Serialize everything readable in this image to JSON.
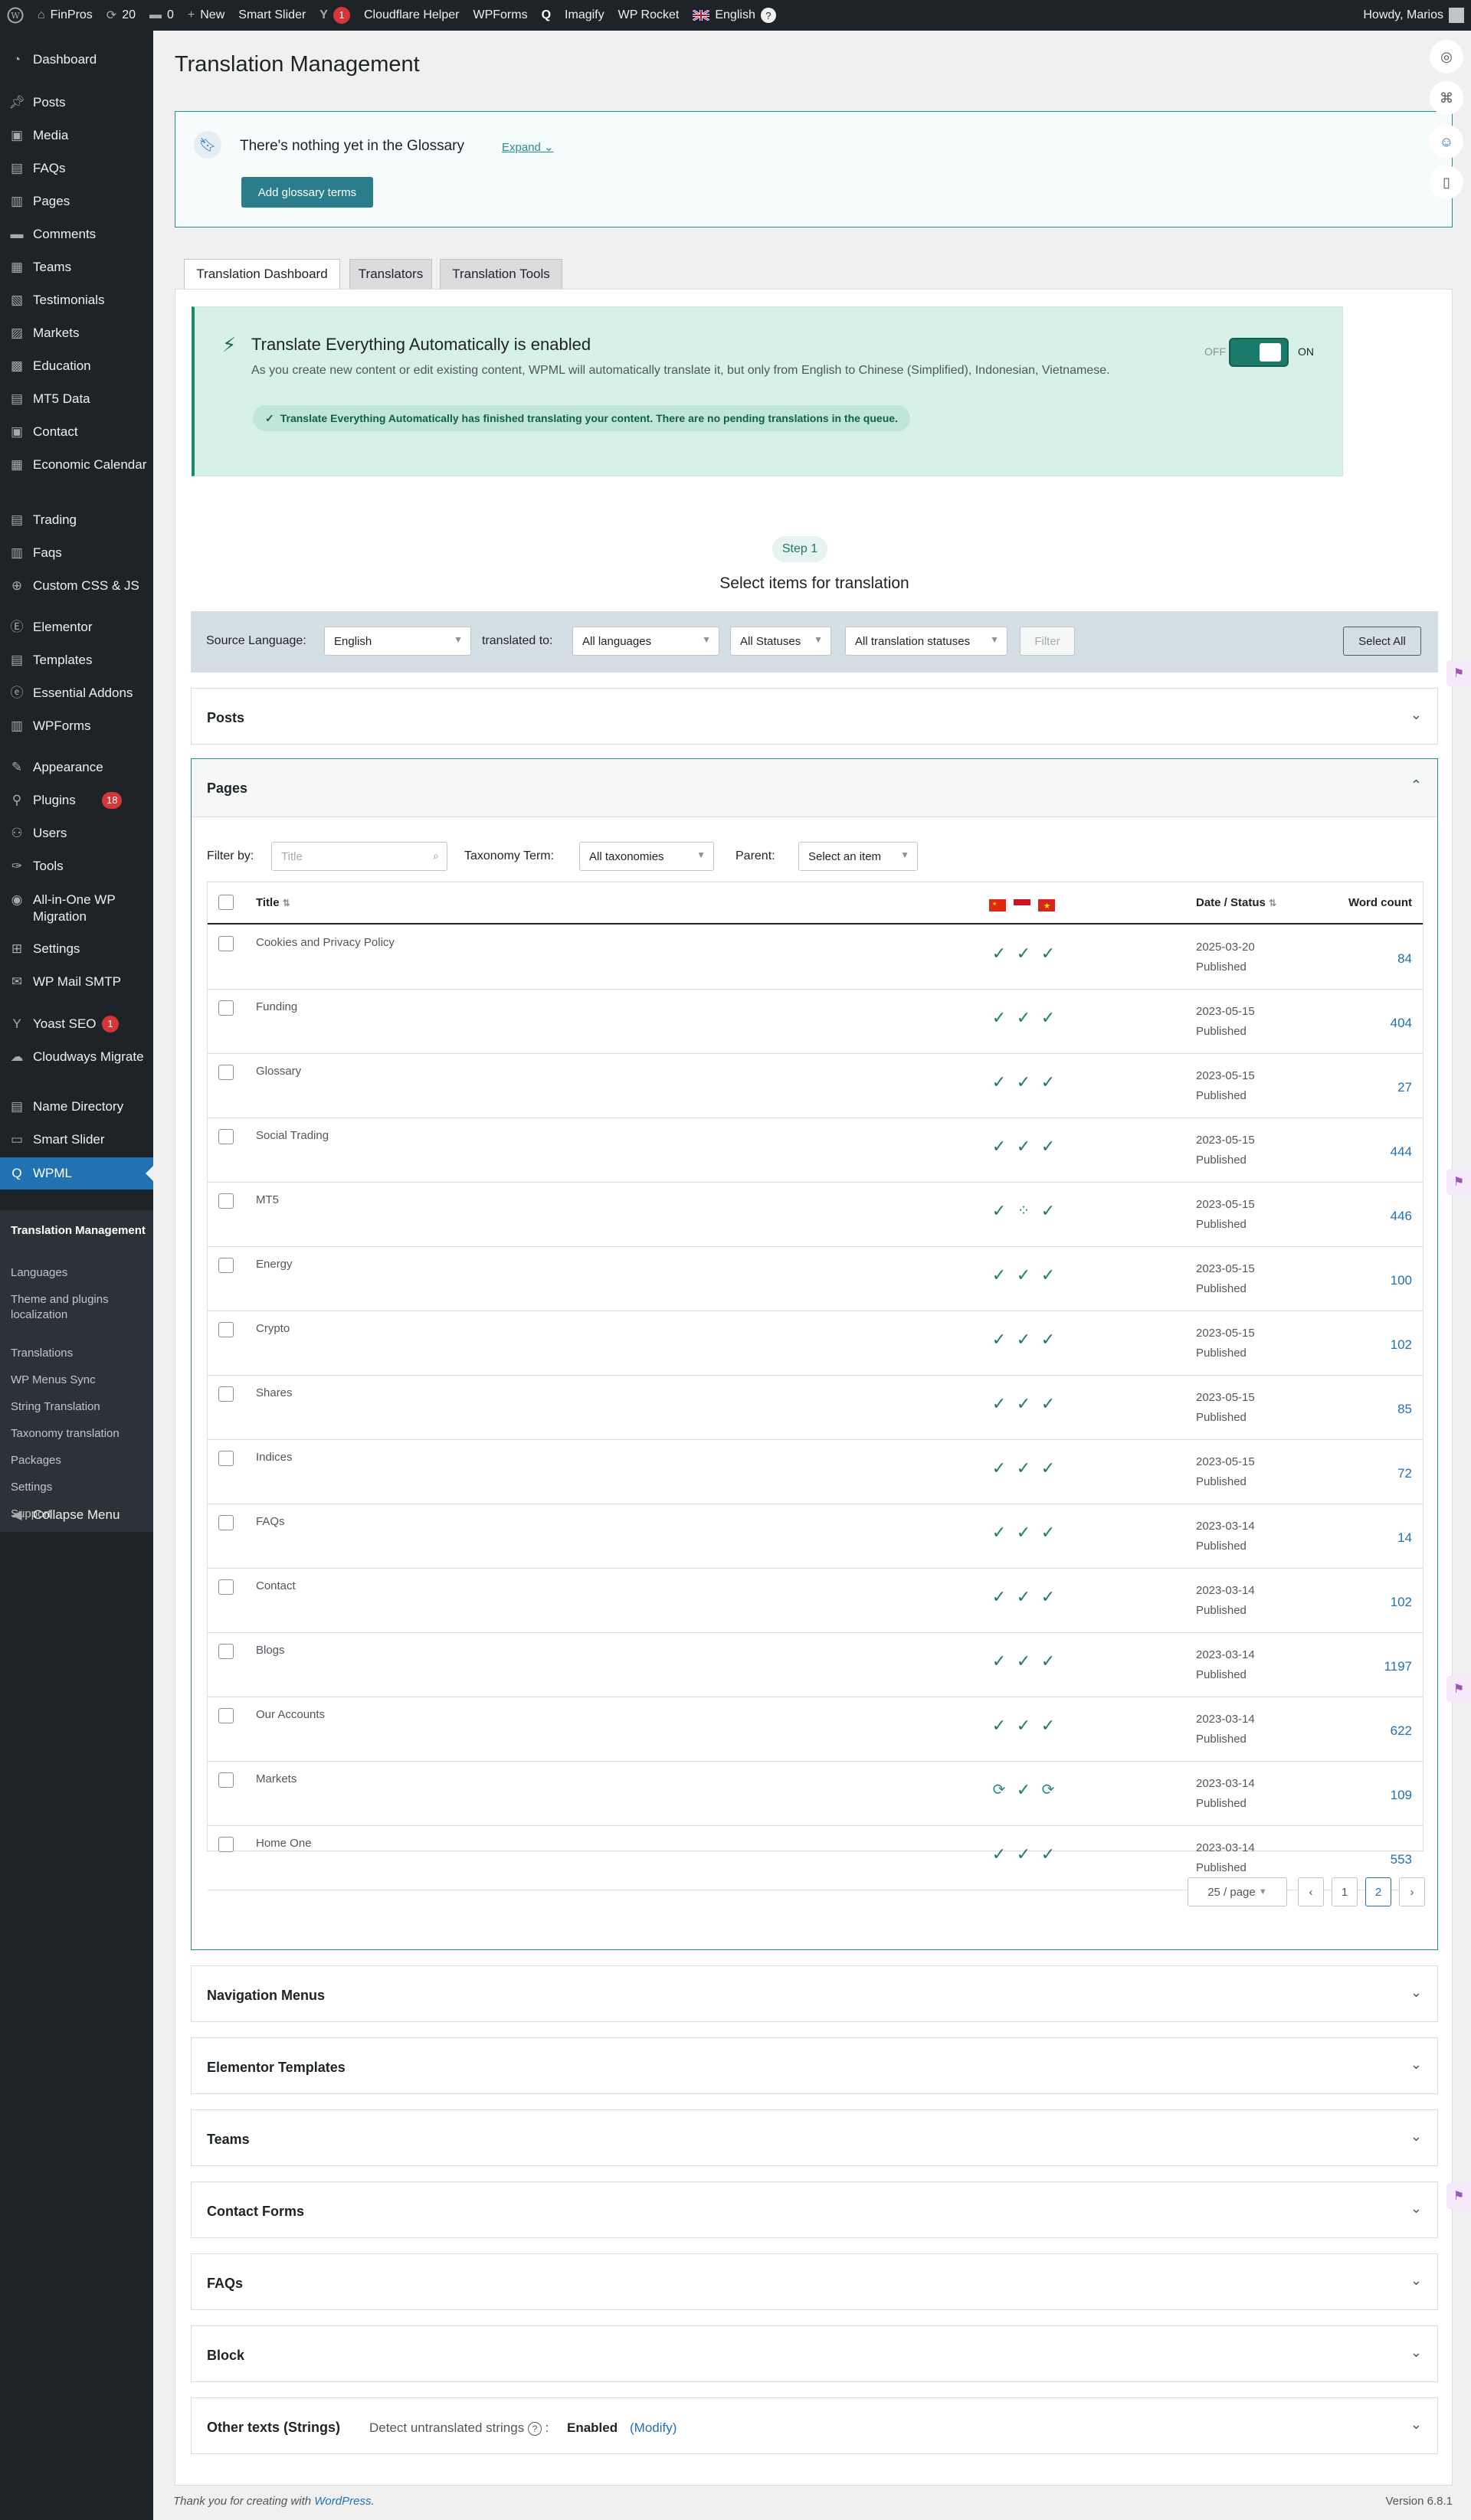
{
  "admin_bar": {
    "site_name": "FinPros",
    "updates_count": "20",
    "comments_count": "0",
    "new_label": "New",
    "smart_slider": "Smart Slider",
    "yoast_badge": "1",
    "cloudflare": "Cloudflare Helper",
    "wpforms": "WPForms",
    "imagify": "Imagify",
    "wp_rocket": "WP Rocket",
    "language": "English",
    "howdy": "Howdy, Marios"
  },
  "sidebar": {
    "items": [
      {
        "label": "Dashboard",
        "icon": "dashboard-icon"
      },
      {
        "label": "Posts",
        "icon": "pin-icon"
      },
      {
        "label": "Media",
        "icon": "media-icon"
      },
      {
        "label": "FAQs",
        "icon": "faq-icon"
      },
      {
        "label": "Pages",
        "icon": "pages-icon"
      },
      {
        "label": "Comments",
        "icon": "comments-icon"
      },
      {
        "label": "Teams",
        "icon": "teams-icon"
      },
      {
        "label": "Testimonials",
        "icon": "testimonials-icon"
      },
      {
        "label": "Markets",
        "icon": "markets-icon"
      },
      {
        "label": "Education",
        "icon": "education-icon"
      },
      {
        "label": "MT5 Data",
        "icon": "data-icon"
      },
      {
        "label": "Contact",
        "icon": "contact-icon"
      },
      {
        "label": "Economic Calendar",
        "icon": "calendar-icon"
      },
      {
        "label": "Trading",
        "icon": "trading-icon"
      },
      {
        "label": "Faqs",
        "icon": "faqs-icon"
      },
      {
        "label": "Custom CSS & JS",
        "icon": "plus-icon"
      },
      {
        "label": "Elementor",
        "icon": "elementor-icon"
      },
      {
        "label": "Templates",
        "icon": "templates-icon"
      },
      {
        "label": "Essential Addons",
        "icon": "addons-icon"
      },
      {
        "label": "WPForms",
        "icon": "wpforms-icon"
      },
      {
        "label": "Appearance",
        "icon": "appearance-icon"
      },
      {
        "label": "Plugins",
        "icon": "plugins-icon",
        "badge": "18"
      },
      {
        "label": "Users",
        "icon": "users-icon"
      },
      {
        "label": "Tools",
        "icon": "tools-icon"
      },
      {
        "label": "All-in-One WP Migration",
        "icon": "migration-icon"
      },
      {
        "label": "Settings",
        "icon": "settings-icon"
      },
      {
        "label": "WP Mail SMTP",
        "icon": "mail-icon"
      },
      {
        "label": "Yoast SEO",
        "icon": "yoast-icon",
        "badge": "1"
      },
      {
        "label": "Cloudways Migrate",
        "icon": "cloud-icon"
      },
      {
        "label": "Name Directory",
        "icon": "directory-icon"
      },
      {
        "label": "Smart Slider",
        "icon": "slider-icon"
      },
      {
        "label": "WPML",
        "icon": "wpml-icon"
      }
    ],
    "submenu": [
      "Translation Management",
      "Languages",
      "Theme and plugins localization",
      "Translations",
      "WP Menus Sync",
      "String Translation",
      "Taxonomy translation",
      "Packages",
      "Settings",
      "Support"
    ],
    "collapse": "Collapse Menu"
  },
  "page": {
    "title": "Translation Management",
    "glossary": {
      "title": "There's nothing yet in the Glossary",
      "expand": "Expand",
      "button": "Add glossary terms"
    },
    "tabs": [
      "Translation Dashboard",
      "Translators",
      "Translation Tools"
    ],
    "notice": {
      "title": "Translate Everything Automatically is enabled",
      "description": "As you create new content or edit existing content, WPML will automatically translate it, but only from English to Chinese (Simplified), Indonesian, Vietnamese.",
      "status": "Translate Everything Automatically has finished translating your content. There are no pending translations in the queue.",
      "off": "OFF",
      "on": "ON"
    },
    "step": "Step 1",
    "select_title": "Select items for translation",
    "filters": {
      "source_label": "Source Language:",
      "source_value": "English",
      "translated_label": "translated to:",
      "languages": "All languages",
      "statuses": "All Statuses",
      "translation_statuses": "All translation statuses",
      "filter_button": "Filter",
      "select_all": "Select All"
    },
    "sections": [
      "Posts",
      "Navigation Menus",
      "Elementor Templates",
      "Teams",
      "Contact Forms",
      "FAQs",
      "Block"
    ],
    "pages_section": {
      "title": "Pages",
      "filter_by": "Filter by:",
      "title_placeholder": "Title",
      "taxonomy_label": "Taxonomy Term:",
      "taxonomy_value": "All taxonomies",
      "parent_label": "Parent:",
      "parent_value": "Select an item",
      "columns": {
        "title": "Title",
        "date": "Date / Status",
        "wordcount": "Word count"
      },
      "flag_colors": [
        "#de2910",
        "#ce1126",
        "#da251d"
      ],
      "rows": [
        {
          "title": "Cookies and Privacy Policy",
          "date": "2025-03-20",
          "status": "Published",
          "words": "84",
          "s": [
            "✓",
            "✓",
            "✓"
          ]
        },
        {
          "title": "Funding",
          "date": "2023-05-15",
          "status": "Published",
          "words": "404",
          "s": [
            "✓",
            "✓",
            "✓"
          ]
        },
        {
          "title": "Glossary",
          "date": "2023-05-15",
          "status": "Published",
          "words": "27",
          "s": [
            "✓",
            "✓",
            "✓"
          ]
        },
        {
          "title": "Social Trading",
          "date": "2023-05-15",
          "status": "Published",
          "words": "444",
          "s": [
            "✓",
            "✓",
            "✓"
          ]
        },
        {
          "title": "MT5",
          "date": "2023-05-15",
          "status": "Published",
          "words": "446",
          "s": [
            "✓",
            "⁘",
            "✓"
          ]
        },
        {
          "title": "Energy",
          "date": "2023-05-15",
          "status": "Published",
          "words": "100",
          "s": [
            "✓",
            "✓",
            "✓"
          ]
        },
        {
          "title": "Crypto",
          "date": "2023-05-15",
          "status": "Published",
          "words": "102",
          "s": [
            "✓",
            "✓",
            "✓"
          ]
        },
        {
          "title": "Shares",
          "date": "2023-05-15",
          "status": "Published",
          "words": "85",
          "s": [
            "✓",
            "✓",
            "✓"
          ]
        },
        {
          "title": "Indices",
          "date": "2023-05-15",
          "status": "Published",
          "words": "72",
          "s": [
            "✓",
            "✓",
            "✓"
          ]
        },
        {
          "title": "FAQs",
          "date": "2023-03-14",
          "status": "Published",
          "words": "14",
          "s": [
            "✓",
            "✓",
            "✓"
          ]
        },
        {
          "title": "Contact",
          "date": "2023-03-14",
          "status": "Published",
          "words": "102",
          "s": [
            "✓",
            "✓",
            "✓"
          ]
        },
        {
          "title": "Blogs",
          "date": "2023-03-14",
          "status": "Published",
          "words": "1197",
          "s": [
            "✓",
            "✓",
            "✓"
          ]
        },
        {
          "title": "Our Accounts",
          "date": "2023-03-14",
          "status": "Published",
          "words": "622",
          "s": [
            "✓",
            "✓",
            "✓"
          ]
        },
        {
          "title": "Markets",
          "date": "2023-03-14",
          "status": "Published",
          "words": "109",
          "s": [
            "⟳",
            "✓",
            "⟳"
          ]
        },
        {
          "title": "Home One",
          "date": "2023-03-14",
          "status": "Published",
          "words": "553",
          "s": [
            "✓",
            "✓",
            "✓"
          ]
        }
      ],
      "pagination": {
        "per_page": "25 / page",
        "pages": [
          "1",
          "2"
        ],
        "current": "2"
      }
    },
    "strings_section": {
      "title": "Other texts (Strings)",
      "detect_label": "Detect untranslated strings",
      "value": "Enabled",
      "modify": "(Modify)"
    },
    "footer": {
      "text": "Thank you for creating with",
      "link": "WordPress.",
      "version": "Version 6.8.1"
    }
  }
}
